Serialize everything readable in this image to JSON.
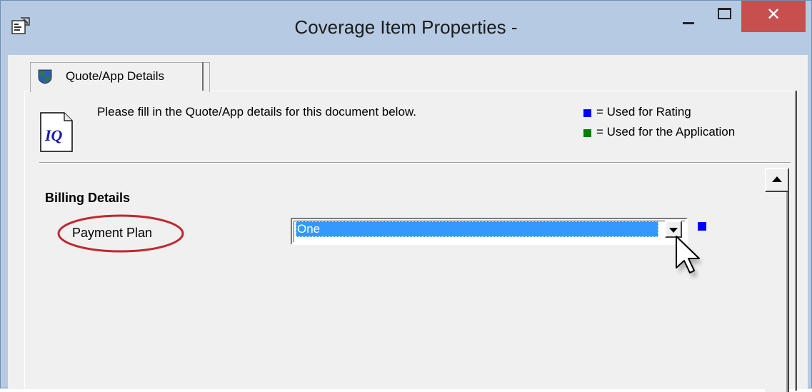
{
  "window": {
    "title": "Coverage Item Properties -",
    "minimize_icon": "minimize-icon",
    "maximize_icon": "maximize-icon",
    "close_label": "✕"
  },
  "tabs": [
    {
      "label": "Quote/App Details",
      "icon": "shield-grid-icon",
      "active": true
    }
  ],
  "header": {
    "doc_icon_text": "IQ",
    "instruction": "Please fill in the Quote/App details for this document below."
  },
  "legend": [
    {
      "color": "#0000ff",
      "label": "= Used for Rating"
    },
    {
      "color": "#008000",
      "label": "= Used for the Application"
    }
  ],
  "form": {
    "section_title": "Billing Details",
    "fields": [
      {
        "label": "Payment Plan",
        "value": "One",
        "indicator_color": "#0000ff",
        "highlighted": true
      }
    ]
  },
  "colors": {
    "titlebar": "#b6cbe3",
    "close_button": "#c7504f",
    "selection": "#3399ff",
    "highlight_ellipse": "#c0282d"
  }
}
